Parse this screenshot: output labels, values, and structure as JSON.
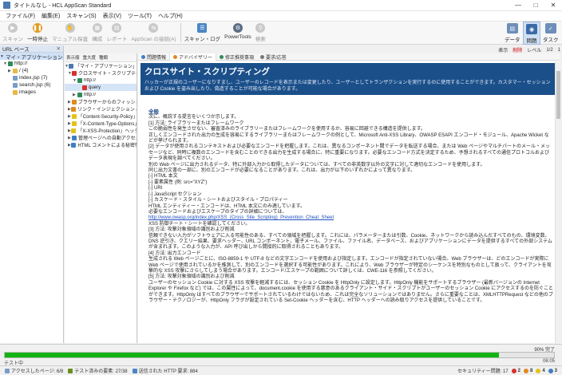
{
  "window": {
    "title": "タイトルなし - HCL AppScan Standard"
  },
  "menu": [
    "ファイル(F)",
    "編集(E)",
    "スキャン(S)",
    "表示(V)",
    "ツール(T)",
    "ヘルプ(H)"
  ],
  "toolbar": {
    "scan": "スキャン",
    "pause": "一時停止",
    "manual": "マニュアル探査",
    "config": "構成",
    "report": "レポート",
    "connect": "AppScan の接続(A)",
    "log": "スキャン・ログ",
    "powertools": "PowerTools",
    "search": "検索",
    "data": "データ",
    "issues": "問題",
    "tasks": "タスク"
  },
  "left_panel": {
    "tab": "URL ベース",
    "root": "マイ・アプリケーション (17)",
    "host": "http://",
    "items": [
      {
        "label": "/ (4)"
      },
      {
        "label": "index.jsp (7)"
      },
      {
        "label": "search.jsp (6)"
      },
      {
        "label": "images"
      }
    ]
  },
  "mid_panel": {
    "headers": [
      "表示順",
      "重大度",
      "種類"
    ],
    "root": "「マイ・アプリケーション」における問題",
    "rows": [
      {
        "label": "クロスサイト・スクリプティング (2)"
      },
      {
        "label": "http://"
      },
      {
        "label": "query"
      },
      {
        "label": "http://"
      },
      {
        "label": "ブラウザーからのフィッシング (2)"
      },
      {
        "label": "リンク・インジェクション (クロスサイト・"
      },
      {
        "label": "「Content-Security-Policy」ヘッダ"
      },
      {
        "label": "「X-Content-Type-Options」ヘッダ"
      },
      {
        "label": "「X-XSS-Protection」ヘッダーがない"
      },
      {
        "label": "管理ページへの自動アクセス (1)"
      },
      {
        "label": "HTML コメントによる秘密情報の開示"
      }
    ]
  },
  "right_tabs": [
    "問題情報",
    "アドバイザリー",
    "修正推奨事項",
    "要求/応答"
  ],
  "top_right": {
    "view": "表示",
    "delete": "削除",
    "level": "レベル",
    "page_nav": "1/2",
    "count": "1"
  },
  "advisory": {
    "title": "クロスサイト・スクリプティング",
    "desc": "ハッカーが正規のユーザーになりすまし、ユーザーのレコードを表示または変更したり、ユーザーとしてトランザクションを実行するのに使用することができます。カスタマー・セッションおよび Cookie を盗み出したり、偽造することが可能な場合があります。",
    "section": "全般",
    "lines": [
      "次に、概説する提言をいくつか示します。",
      "[1] 方法: ライブラリーまたはフレームワーク",
      "この脆弱性を発生させない、審査済みのライブラリーまたはフレームワークを使用するか、容易に回避できる構造を提供します。",
      "正しくエンコードされた出力の生成を容易にするライブラリーまたはフレームワークの例として、Microsoft Anti-XSS Library、OWASP ESAPI エンコード・モジュール、Apache Wicket などが挙げられます。",
      "[2] データが使用されるコンテキストおよび必要なエンコードを把握します。これは、異なるコンポーネント間でデータを転送する場合、または Web ページやマルチパートのメール・メッセージなど、同時に複数のエンコードを含むことのできる出力を生成する場合に、特に重要になります。必要なエンコード方式を決定するため、予想されるすべての通信プロトコルおよびデータ表現を調べてください。",
      "別の Web ページに出力されるデータ、特に外部入力から取得したデータについては、すべての非英数字以外の文字に対して適切なエンコードを使用します。",
      "同じ出力文書の一部に、別のエンコードが必要になることがあります。これは、出力が以下のいずれかによって異なります。",
      "[-] HTML 本文",
      "[-] 要素属性 (例: src=\"XYZ\")",
      "[-] URI",
      "[-] JavaScript セクション",
      "[-] カスケード・スタイル・シートおよびスタイル・プロパティー",
      "HTML エンティティー・エンコードは、HTML 本文にのみ適しています。",
      "必要なエンコードおよびエスケープのタイプの詳細については、",
      "XSS 防御チート・シートを確認してください。",
      "[3] 方法: 攻撃対象領域の識別および削減",
      "信頼できない入力がソフトウェアに入る可能性のある、すべての領域を把握します。これには、パラメーターまたは引数、Cookie、ネットワークから読み込んだすべてのもの、環境変数、DNS 逆引き、クエリー結果、要求ヘッダー、URL コンポーネント、電子メール、ファイル、ファイル名、データベース、およびアプリケーションにデータを提供するすべての外部システムが含まれます。このような入力が、API 呼び出しから間接的に取得されることもあります。",
      "[4] 方法: 出力エンコード",
      "生成される Web ページごとに、ISO-8859-1 や UTF-8 などの文字エンコードを使用および指定します。エンコードが指定されていない場合、Web ブラウザーは、どのエンコードが実際に Web ページで使用されているかを推測して、別のエンコードを選択する可能性があります。これにより、Web ブラウザーが特定のシーケンスを特別なものとして扱って、クライアントを攻撃的な XSS 攻撃にさらしてしまう場合があります。エンコード/エスケープの範囲について詳しくは、CWE-116 を参照してください。",
      "[5] 方法: 攻撃対象領域の識別および削減",
      "ユーザーのセッション Cookie に対する XSS 攻撃を軽減するには、セッション Cookie を HttpOnly に設定します。HttpOnly 機能をサポートするブラウザー (最新バージョンの Internet Explorer や Firefox など) では、この属性によって、document.cookie を使用する悪意のあるクライアント・サイド・スクリプトがユーザーのセッション Cookie にアクセスするのを防ぐことができます。HttpOnly はすべてのブラウザーでサポートされているわけではないため、これは完全なソリューションではありません。さらに重要なことは、XMLHTTPRequest などの他のブラウザー・テクノロジーが、HttpOnly フラグが設定されている Set-Cookie ヘッダーを含む、HTTP ヘッダーへの読み取りアクセスを提供していることです。"
    ],
    "link": "http://www.owasp.org/index.php/XSS_(Cross_Site_Scripting)_Prevention_Cheat_Sheet"
  },
  "progress": {
    "percent_label": "90% 完了",
    "value": 0.9,
    "text": "テスト中",
    "time": "06:05"
  },
  "status": {
    "visited": "アクセスしたページ: 6/8",
    "tests": "テスト済みの要素: 27/38",
    "requests": "送信された HTTP 要求: 884",
    "issues_label": "セキュリティー問題: 17",
    "high": "2",
    "medium": "8",
    "low": "4",
    "info": "3"
  },
  "colors": {
    "banner": "#1b4f8a",
    "progress": "#13b313",
    "accent": "#2b6cb0"
  }
}
